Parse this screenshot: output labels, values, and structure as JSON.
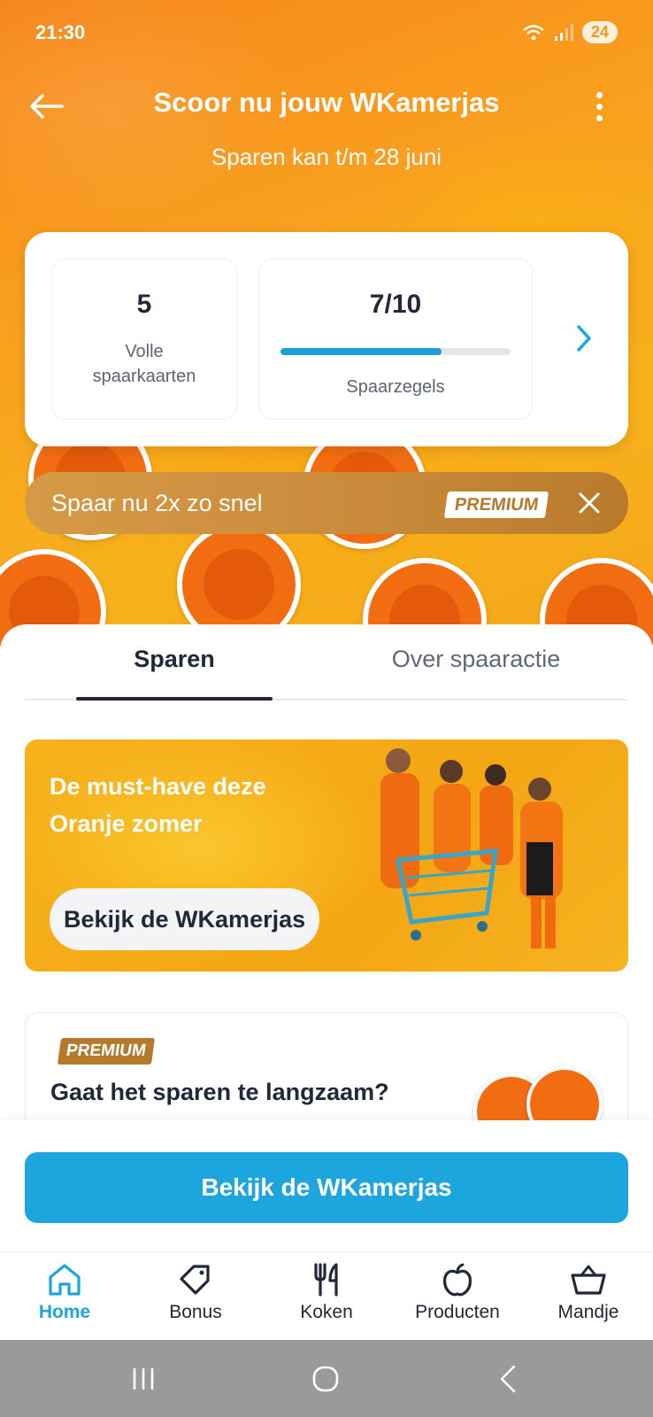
{
  "status_bar": {
    "time": "21:30",
    "battery": "24"
  },
  "header": {
    "title": "Scoor nu jouw WKamerjas",
    "subtitle": "Sparen kan t/m 28 juni"
  },
  "stats": {
    "full_cards_value": "5",
    "full_cards_label": "Volle spaarkaarten",
    "stamps_value": "7/10",
    "stamps_progress": 0.7,
    "stamps_label": "Spaarzegels"
  },
  "premium_banner": {
    "text": "Spaar nu 2x zo snel",
    "tag": "PREMIUM"
  },
  "tabs": [
    {
      "label": "Sparen",
      "active": true
    },
    {
      "label": "Over spaaractie",
      "active": false
    }
  ],
  "promo": {
    "title": "De must-have deze Oranje zomer",
    "button": "Bekijk de WKamerjas"
  },
  "premium_card": {
    "tag": "PREMIUM",
    "title": "Gaat het sparen te langzaam?"
  },
  "cta": {
    "label": "Bekijk de WKamerjas"
  },
  "bottom_nav": [
    {
      "label": "Home",
      "icon": "home-icon",
      "active": true
    },
    {
      "label": "Bonus",
      "icon": "tag-icon",
      "active": false
    },
    {
      "label": "Koken",
      "icon": "cutlery-icon",
      "active": false
    },
    {
      "label": "Producten",
      "icon": "apple-icon",
      "active": false
    },
    {
      "label": "Mandje",
      "icon": "basket-icon",
      "active": false
    }
  ],
  "colors": {
    "accent": "#1ca6dd",
    "premium": "#b57a2c",
    "hero_orange": "#f7971c"
  }
}
